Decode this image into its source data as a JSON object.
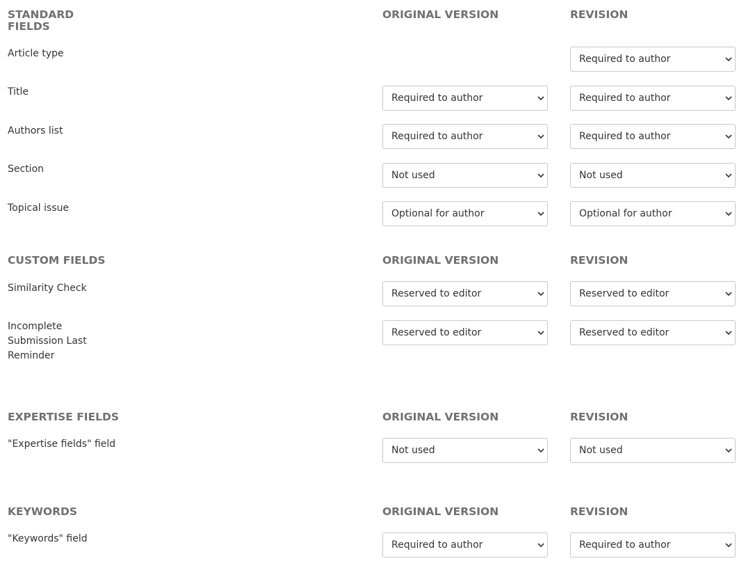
{
  "column_headers": {
    "original": "ORIGINAL VERSION",
    "revision": "REVISION"
  },
  "sections": [
    {
      "title_line1": "STANDARD",
      "title_line2": "FIELDS",
      "fields": [
        {
          "label": "Article type",
          "original": null,
          "revision": "Required to author"
        },
        {
          "label": "Title",
          "original": "Required to author",
          "revision": "Required to author"
        },
        {
          "label": "Authors list",
          "original": "Required to author",
          "revision": "Required to author"
        },
        {
          "label": "Section",
          "original": "Not used",
          "revision": "Not used"
        },
        {
          "label": "Topical issue",
          "original": "Optional for author",
          "revision": "Optional for author"
        }
      ]
    },
    {
      "title": "CUSTOM FIELDS",
      "fields": [
        {
          "label": "Similarity Check",
          "original": "Reserved to editor",
          "revision": "Reserved to editor"
        },
        {
          "label_line1": "Incomplete",
          "label_line2": "Submission Last",
          "label_line3": "Reminder",
          "original": "Reserved to editor",
          "revision": "Reserved to editor"
        }
      ]
    },
    {
      "title": "EXPERTISE FIELDS",
      "fields": [
        {
          "label": "\"Expertise fields\" field",
          "original": "Not used",
          "revision": "Not used"
        }
      ]
    },
    {
      "title": "KEYWORDS",
      "fields": [
        {
          "label": "\"Keywords\" field",
          "original": "Required to author",
          "revision": "Required to author"
        }
      ]
    }
  ],
  "icons": {
    "select_arrow": "chevron-down-icon"
  },
  "colors": {
    "header_text": "#707070",
    "label_text": "#333333",
    "select_border": "#c8c8c8"
  }
}
